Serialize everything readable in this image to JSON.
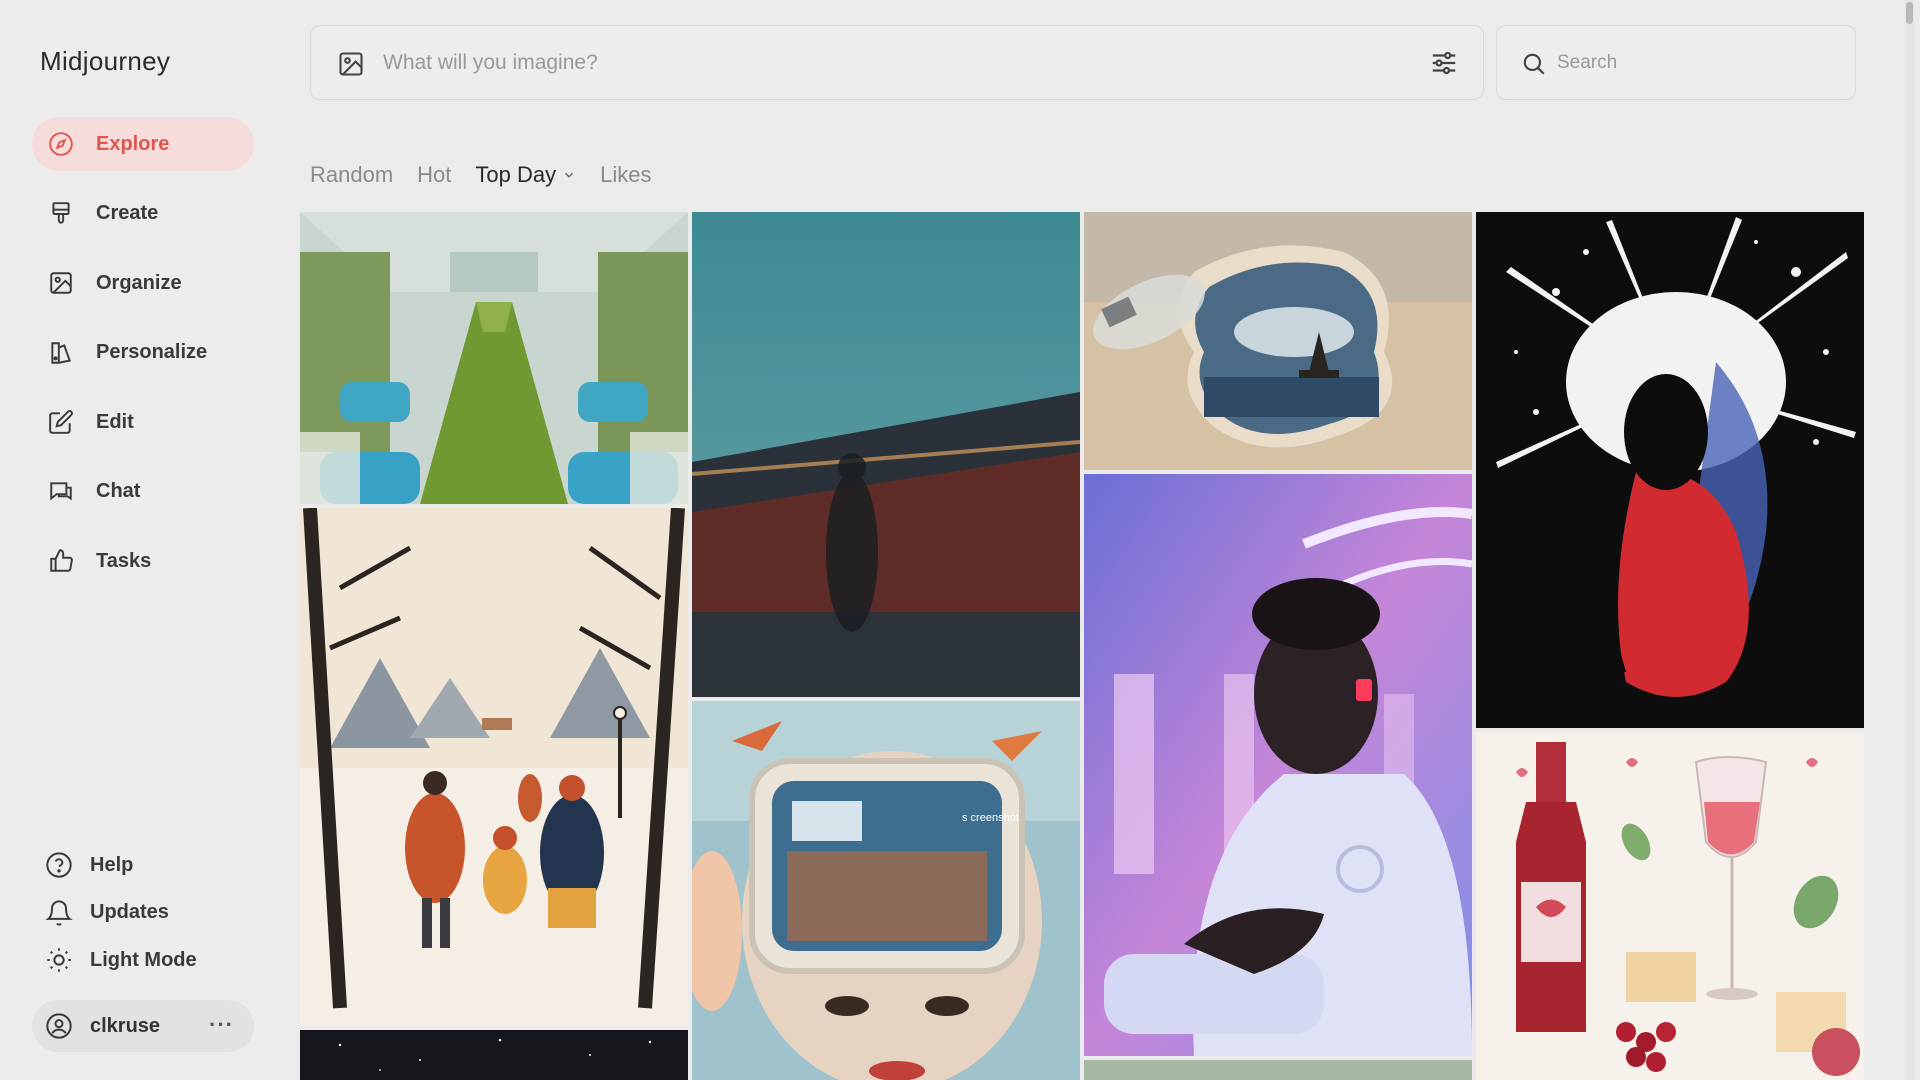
{
  "app": {
    "name": "Midjourney"
  },
  "sidebar": {
    "items": [
      {
        "label": "Explore",
        "icon": "compass-icon",
        "active": true
      },
      {
        "label": "Create",
        "icon": "paintbrush-icon"
      },
      {
        "label": "Organize",
        "icon": "image-icon"
      },
      {
        "label": "Personalize",
        "icon": "personalize-icon"
      },
      {
        "label": "Edit",
        "icon": "edit-icon"
      },
      {
        "label": "Chat",
        "icon": "chat-icon"
      },
      {
        "label": "Tasks",
        "icon": "thumbs-up-icon"
      }
    ],
    "bottom_items": [
      {
        "label": "Help",
        "icon": "help-icon"
      },
      {
        "label": "Updates",
        "icon": "bell-icon"
      },
      {
        "label": "Light Mode",
        "icon": "sun-icon"
      }
    ],
    "user": {
      "name": "clkruse",
      "more": "···"
    }
  },
  "prompt": {
    "placeholder": "What will you imagine?"
  },
  "search": {
    "placeholder": "Search"
  },
  "tabs": [
    {
      "label": "Random"
    },
    {
      "label": "Hot"
    },
    {
      "label": "Top Day",
      "active": true,
      "has_dropdown": true
    },
    {
      "label": "Likes"
    }
  ],
  "gallery": {
    "images": [
      {
        "name": "train-meadow-image"
      },
      {
        "name": "blurred-figure-train-image"
      },
      {
        "name": "bottle-ship-sand-image"
      },
      {
        "name": "paint-splash-silhouette-image"
      },
      {
        "name": "winter-family-walk-image"
      },
      {
        "name": "screenshot-face-collage-image",
        "caption": "s creenshot"
      },
      {
        "name": "neon-portrait-man-image"
      },
      {
        "name": "wine-watercolor-image"
      },
      {
        "name": "starry-night-image"
      },
      {
        "name": "landscape-partial-image"
      }
    ]
  },
  "colors": {
    "accent": "#e0564f",
    "active_bg": "#f7dcdc",
    "background": "#ebebeb"
  }
}
